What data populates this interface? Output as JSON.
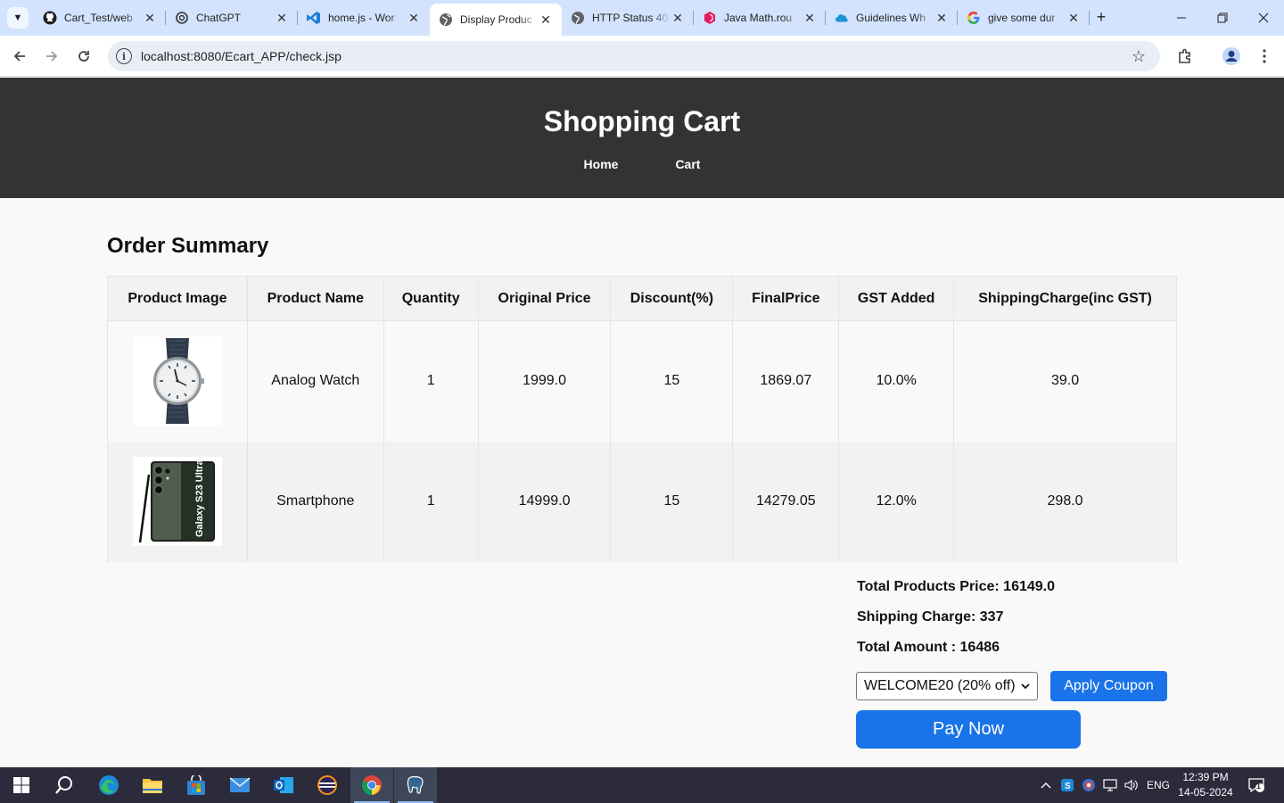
{
  "browser": {
    "tabs": [
      {
        "title": "Cart_Test/web",
        "icon": "github-icon"
      },
      {
        "title": "ChatGPT",
        "icon": "chatgpt-icon"
      },
      {
        "title": "home.js - Wor",
        "icon": "vscode-icon"
      },
      {
        "title": "Display Produc",
        "icon": "globe-icon",
        "active": true
      },
      {
        "title": "HTTP Status 40",
        "icon": "globe-icon"
      },
      {
        "title": "Java Math.rou",
        "icon": "geeks-icon"
      },
      {
        "title": "Guidelines Wh",
        "icon": "cloud-icon"
      },
      {
        "title": "give some dur",
        "icon": "google-icon"
      }
    ],
    "url": "localhost:8080/Ecart_APP/check.jsp"
  },
  "header": {
    "title": "Shopping Cart",
    "nav": [
      "Home",
      "Cart"
    ]
  },
  "order": {
    "title": "Order Summary",
    "columns": [
      "Product Image",
      "Product Name",
      "Quantity",
      "Original Price",
      "Discount(%)",
      "FinalPrice",
      "GST Added",
      "ShippingCharge(inc GST)"
    ],
    "rows": [
      {
        "image": "watch-image",
        "name": "Analog Watch",
        "quantity": "1",
        "original_price": "1999.0",
        "discount": "15",
        "final_price": "1869.07",
        "gst": "10.0%",
        "shipping": "39.0"
      },
      {
        "image": "phone-image",
        "name": "Smartphone",
        "quantity": "1",
        "original_price": "14999.0",
        "discount": "15",
        "final_price": "14279.05",
        "gst": "12.0%",
        "shipping": "298.0"
      }
    ]
  },
  "totals": {
    "products_price": "Total Products Price: 16149.0",
    "shipping_charge": "Shipping Charge: 337",
    "total_amount": "Total Amount : 16486"
  },
  "coupon": {
    "selected": "WELCOME20 (20% off)",
    "apply_label": "Apply Coupon"
  },
  "pay_label": "Pay Now",
  "phone_text": "Galaxy S23 Ultra",
  "taskbar": {
    "lang": "ENG",
    "time": "12:39 PM",
    "date": "14-05-2024",
    "notification_count": "1"
  },
  "colors": {
    "header_bg": "#333333",
    "accent": "#1a73e8",
    "tabstrip_bg": "#d3e3fd"
  }
}
